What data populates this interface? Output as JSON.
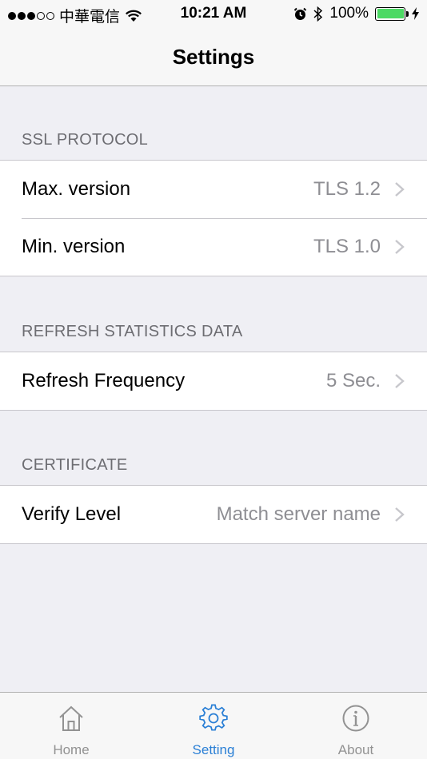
{
  "status_bar": {
    "carrier": "中華電信",
    "time": "10:21 AM",
    "battery_percent": "100%",
    "battery_level": 1.0,
    "signal_bars_filled": 3,
    "signal_bars_total": 5
  },
  "nav": {
    "title": "Settings"
  },
  "sections": [
    {
      "header": "SSL PROTOCOL",
      "rows": [
        {
          "label": "Max. version",
          "value": "TLS 1.2"
        },
        {
          "label": "Min. version",
          "value": "TLS 1.0"
        }
      ]
    },
    {
      "header": "REFRESH STATISTICS DATA",
      "rows": [
        {
          "label": "Refresh Frequency",
          "value": "5 Sec."
        }
      ]
    },
    {
      "header": "CERTIFICATE",
      "rows": [
        {
          "label": "Verify Level",
          "value": "Match server name"
        }
      ]
    }
  ],
  "tabs": [
    {
      "label": "Home",
      "icon": "home-icon",
      "active": false
    },
    {
      "label": "Setting",
      "icon": "gear-icon",
      "active": true
    },
    {
      "label": "About",
      "icon": "info-icon",
      "active": false
    }
  ],
  "colors": {
    "accent": "#2a7fd5",
    "battery": "#4cd964",
    "background": "#efeff4",
    "secondary_text": "#8e8e93"
  }
}
